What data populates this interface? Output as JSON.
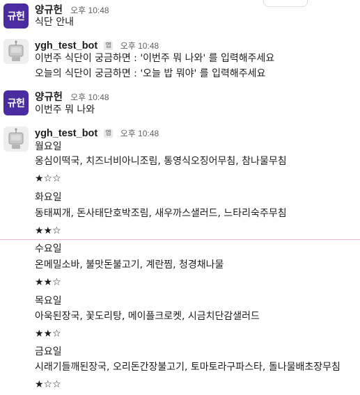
{
  "messages": [
    {
      "avatar_text": "규헌",
      "avatar_color": "#4a2ca0",
      "sender": "양규헌",
      "time": "오후 10:48",
      "lines": [
        "식단 안내"
      ]
    },
    {
      "avatar_icon": "robot-icon",
      "sender": "ygh_test_bot",
      "badge": "앱",
      "time": "오후 10:48",
      "lines": [
        "이번주 식단이 궁금하면 : '이번주 뭐 나와' 를 입력해주세요",
        "오늘의 식단이 궁금하면 : '오늘 밥 뭐야' 를 입력해주세요"
      ]
    },
    {
      "avatar_text": "규헌",
      "avatar_color": "#4a2ca0",
      "sender": "양규헌",
      "time": "오후 10:48",
      "lines": [
        "이번주 뭐 나와"
      ]
    },
    {
      "avatar_icon": "robot-icon",
      "sender": "ygh_test_bot",
      "badge": "앱",
      "time": "오후 10:48",
      "days": [
        {
          "day": "월요일",
          "menu": "옹심이떡국, 치즈너비아니조림, 통영식오징어무침, 참나물무침",
          "rating": "★☆☆"
        },
        {
          "day": "화요일",
          "menu": "동태찌개, 돈사태단호박조림, 새우까스샐러드, 느타리숙주무침",
          "rating": "★★☆"
        },
        {
          "day": "수요일",
          "menu": "온메밀소바, 불맛돈불고기, 계란찜, 청경채나물",
          "rating": "★★☆"
        },
        {
          "day": "목요일",
          "menu": "아욱된장국, 꽃도리탕, 메이플크로켓, 시금치단감샐러드",
          "rating": "★★☆"
        },
        {
          "day": "금요일",
          "menu": "시래기들깨된장국, 오리돈간장불고기, 토마토라구파스타, 돌나물배초장무침",
          "rating": "★☆☆"
        }
      ]
    }
  ]
}
